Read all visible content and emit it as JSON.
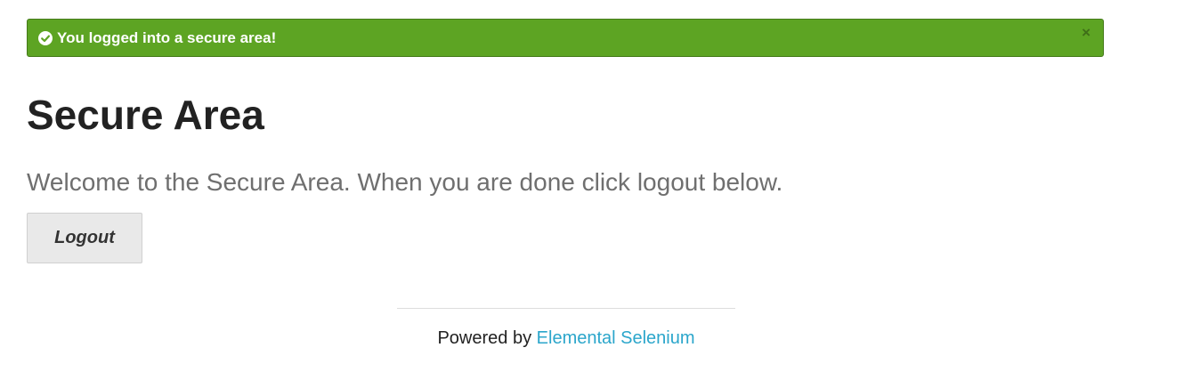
{
  "flash": {
    "message": "You logged into a secure area!",
    "close_label": "×",
    "color": "#5da423",
    "icon": "check-circle-icon"
  },
  "page": {
    "title": "Secure Area",
    "subheader": "Welcome to the Secure Area. When you are done click logout below."
  },
  "logout_button": {
    "label": "Logout"
  },
  "footer": {
    "prefix": "Powered by",
    "link_text": "Elemental Selenium",
    "link_color": "#2ba6cb"
  }
}
